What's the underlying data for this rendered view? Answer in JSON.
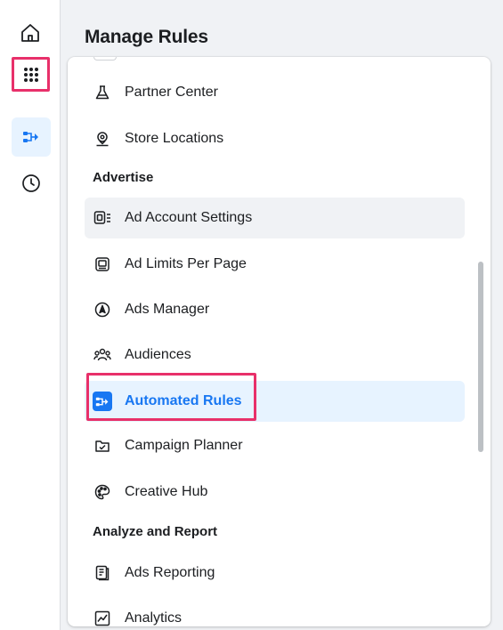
{
  "rail": {
    "items": [
      {
        "name": "home-icon"
      },
      {
        "name": "all-tools-icon"
      },
      {
        "name": "automated-rules-icon"
      },
      {
        "name": "recent-activity-icon"
      }
    ]
  },
  "main": {
    "title": "Manage Rules"
  },
  "menu": {
    "items_top": [
      {
        "label": "Partner Center",
        "icon": "flask-icon"
      },
      {
        "label": "Store Locations",
        "icon": "location-pin-icon"
      }
    ],
    "section_advertise": "Advertise",
    "advertise_items": [
      {
        "label": "Ad Account Settings",
        "icon": "ad-account-settings-icon"
      },
      {
        "label": "Ad Limits Per Page",
        "icon": "ad-limits-icon"
      },
      {
        "label": "Ads Manager",
        "icon": "compass-icon"
      },
      {
        "label": "Audiences",
        "icon": "people-icon"
      },
      {
        "label": "Automated Rules",
        "icon": "automated-rules-icon"
      },
      {
        "label": "Campaign Planner",
        "icon": "campaign-planner-icon"
      },
      {
        "label": "Creative Hub",
        "icon": "palette-icon"
      }
    ],
    "section_analyze": "Analyze and Report",
    "analyze_items": [
      {
        "label": "Ads Reporting",
        "icon": "report-icon"
      },
      {
        "label": "Analytics",
        "icon": "line-chart-icon"
      }
    ]
  },
  "colors": {
    "highlight": "#e8306a",
    "accent": "#1877f2"
  }
}
